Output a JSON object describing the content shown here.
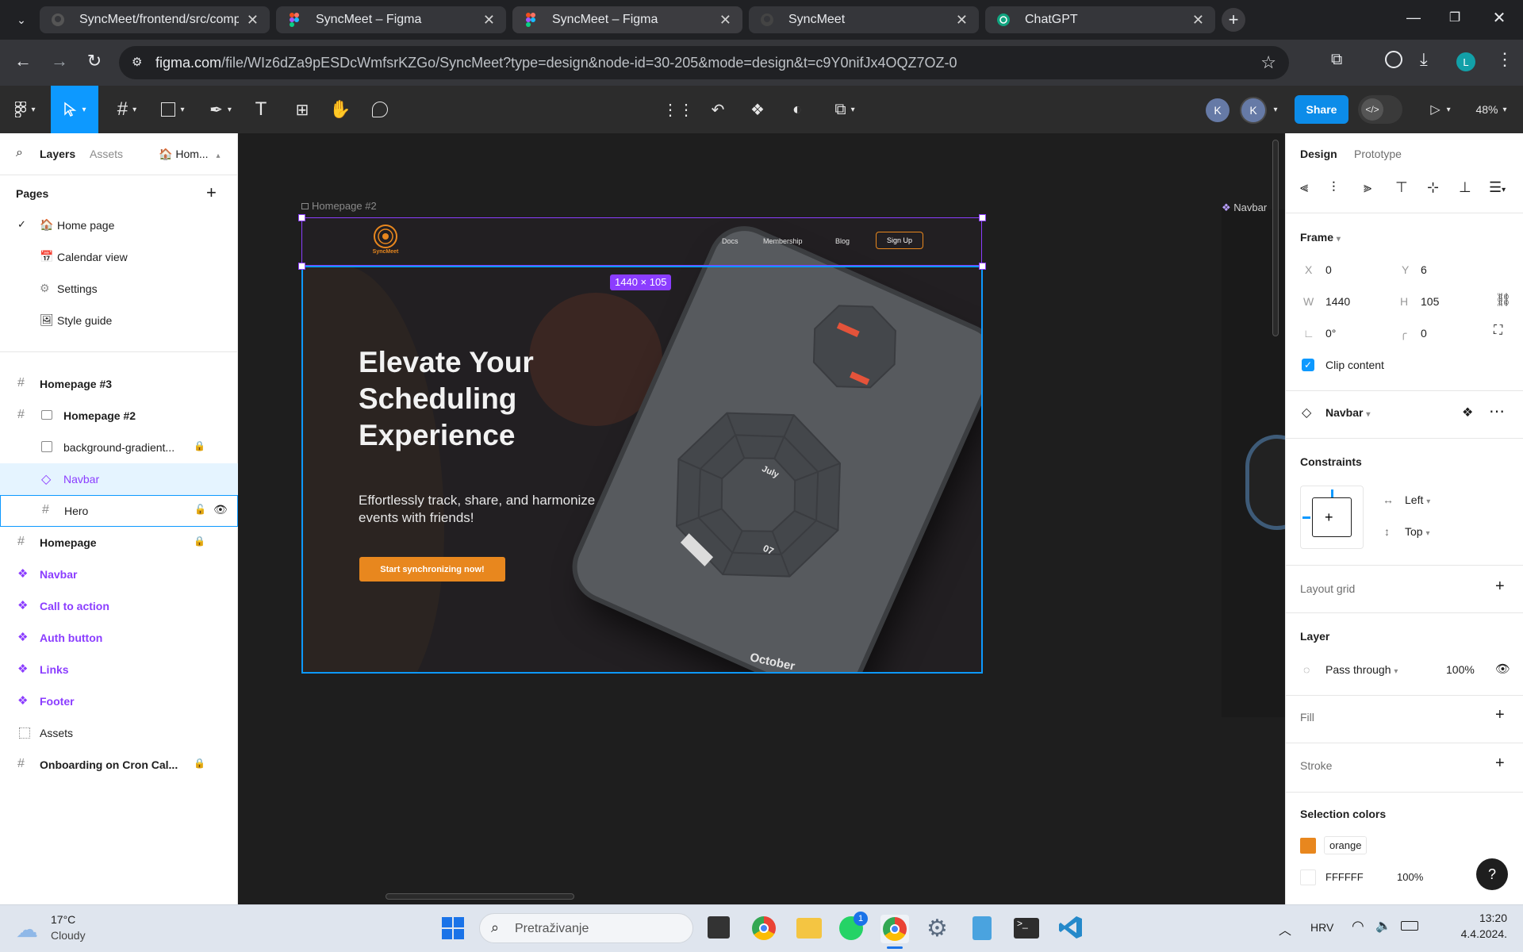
{
  "browser": {
    "tabs": [
      {
        "title": "SyncMeet/frontend/src/compor",
        "icon": "github-icon"
      },
      {
        "title": "SyncMeet – Figma",
        "icon": "figma-icon"
      },
      {
        "title": "SyncMeet – Figma",
        "icon": "figma-icon"
      },
      {
        "title": "SyncMeet",
        "icon": "github-icon"
      },
      {
        "title": "ChatGPT",
        "icon": "chatgpt-icon"
      }
    ],
    "url_host": "figma.com",
    "url_path": "/file/WIz6dZa9pESDcWmfsrKZGo/SyncMeet?type=design&node-id=30-205&mode=design&t=c9Y0nifJx4OQZ7OZ-0",
    "profile_initial": "L"
  },
  "toolbar": {
    "avatar_1": "K",
    "avatar_2": "K",
    "share_label": "Share",
    "zoom": "48%"
  },
  "left": {
    "tab_layers": "Layers",
    "tab_assets": "Assets",
    "page_chip": "Hom...",
    "pages_heading": "Pages",
    "pages": [
      {
        "label": "Home page",
        "emoji": "🏠",
        "active": true
      },
      {
        "label": "Calendar view",
        "emoji": "📅"
      },
      {
        "label": "Settings",
        "emoji": "⚙"
      },
      {
        "label": "Style guide",
        "emoji": "🖼"
      }
    ],
    "layers": [
      {
        "label": "Homepage #3",
        "type": "frame",
        "bold": true
      },
      {
        "label": "Homepage #2",
        "type": "section",
        "bold": true,
        "indent": 1
      },
      {
        "label": "background-gradient...",
        "type": "image",
        "indent": 1,
        "lock": true
      },
      {
        "label": "Navbar",
        "type": "instance",
        "indent": 1,
        "selected": true
      },
      {
        "label": "Hero",
        "type": "frame",
        "indent": 1,
        "hover": true
      },
      {
        "label": "Homepage",
        "type": "frame",
        "bold": true,
        "lock": true
      },
      {
        "label": "Navbar",
        "type": "component",
        "bold": true
      },
      {
        "label": "Call to action",
        "type": "component",
        "bold": true
      },
      {
        "label": "Auth button",
        "type": "component",
        "bold": true
      },
      {
        "label": "Links",
        "type": "component",
        "bold": true
      },
      {
        "label": "Footer",
        "type": "component",
        "bold": true
      },
      {
        "label": "Assets",
        "type": "section-dotted"
      },
      {
        "label": "Onboarding on Cron Cal...",
        "type": "frame",
        "bold": true,
        "lock": true
      }
    ]
  },
  "canvas": {
    "frame_label": "Homepage #2",
    "size_badge": "1440 × 105",
    "right_label": "Navbar",
    "design": {
      "logo_text": "SyncMeet",
      "nav_links": [
        "Docs",
        "Membership",
        "Blog"
      ],
      "signup": "Sign Up",
      "hero_title_lines": [
        "Elevate Your",
        "Scheduling",
        "Experience"
      ],
      "hero_sub_lines": [
        "Effortlessly track, share, and harmonize",
        "events with friends!"
      ],
      "cta": "Start synchronizing now!",
      "calendar_month_top": "July",
      "calendar_day": "07",
      "calendar_month_bottom": "October"
    }
  },
  "right": {
    "tab_design": "Design",
    "tab_prototype": "Prototype",
    "frame_heading": "Frame",
    "x_label": "X",
    "x": "0",
    "y_label": "Y",
    "y": "6",
    "w_label": "W",
    "w": "1440",
    "h_label": "H",
    "h": "105",
    "rotation": "0°",
    "radius": "0",
    "clip_content": "Clip content",
    "instance_name": "Navbar",
    "constraints_heading": "Constraints",
    "constraint_h": "Left",
    "constraint_v": "Top",
    "layout_grid": "Layout grid",
    "layer_heading": "Layer",
    "blend": "Pass through",
    "opacity": "100%",
    "fill": "Fill",
    "stroke": "Stroke",
    "selection_colors_heading": "Selection colors",
    "colors": [
      {
        "name": "orange",
        "hex": "#e8871e"
      },
      {
        "name": "FFFFFF",
        "hex": "#ffffff",
        "opacity": "100%"
      }
    ],
    "help": "?"
  },
  "taskbar": {
    "temp": "17°C",
    "weather": "Cloudy",
    "search_placeholder": "Pretraživanje",
    "whatsapp_badge": "1",
    "lang": "HRV",
    "time": "13:20",
    "date": "4.4.2024."
  },
  "colors": {
    "accent": "#0d99ff",
    "purple": "#8b3dff",
    "orange": "#e8871e",
    "share": "#0c8ce9"
  }
}
